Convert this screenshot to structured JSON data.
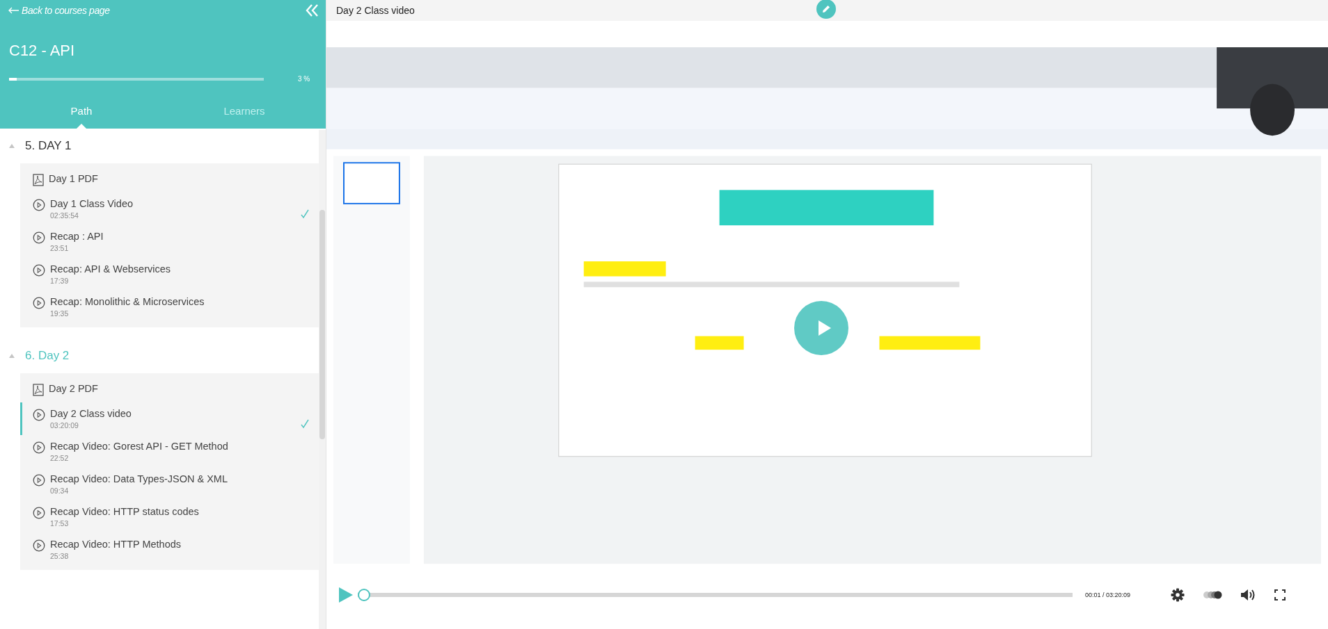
{
  "sidebar": {
    "back_link": "Back to courses page",
    "course_title": "C12 - API",
    "progress": {
      "level": 0.03,
      "label": "3 %"
    },
    "tabs": [
      {
        "label": "Path",
        "selected": true
      },
      {
        "label": "Learners",
        "selected": false
      }
    ],
    "sections": [
      {
        "title": "5. DAY 1",
        "expanded": true,
        "selected": false,
        "items": [
          {
            "kind": "pdf",
            "title": "Day 1 PDF",
            "completed": false,
            "selected": false
          },
          {
            "kind": "video",
            "title": "Day 1 Class Video",
            "duration": "02:35:54",
            "completed": true,
            "selected": false
          },
          {
            "kind": "video",
            "title": "Recap : API",
            "duration": "23:51",
            "completed": false,
            "selected": false
          },
          {
            "kind": "video",
            "title": "Recap: API & Webservices",
            "duration": "17:39",
            "completed": false,
            "selected": false
          },
          {
            "kind": "video",
            "title": "Recap: Monolithic & Microservices",
            "duration": "19:35",
            "completed": false,
            "selected": false
          }
        ]
      },
      {
        "title": "6. Day 2",
        "expanded": true,
        "selected": true,
        "items": [
          {
            "kind": "pdf",
            "title": "Day 2 PDF",
            "completed": false,
            "selected": false
          },
          {
            "kind": "video",
            "title": "Day 2 Class video",
            "duration": "03:20:09",
            "completed": true,
            "selected": true
          },
          {
            "kind": "video",
            "title": "Recap Video: Gorest API - GET Method",
            "duration": "22:52",
            "completed": false,
            "selected": false
          },
          {
            "kind": "video",
            "title": "Recap Video: Data Types-JSON & XML",
            "duration": "09:34",
            "completed": false,
            "selected": false
          },
          {
            "kind": "video",
            "title": "Recap Video: HTTP status codes",
            "duration": "17:53",
            "completed": false,
            "selected": false
          },
          {
            "kind": "video",
            "title": "Recap Video: HTTP Methods",
            "duration": "25:38",
            "completed": false,
            "selected": false
          }
        ]
      }
    ]
  },
  "main": {
    "title": "Day 2 Class video",
    "player": {
      "level": 0.0,
      "time": "00:01 / 03:20:09"
    }
  }
}
